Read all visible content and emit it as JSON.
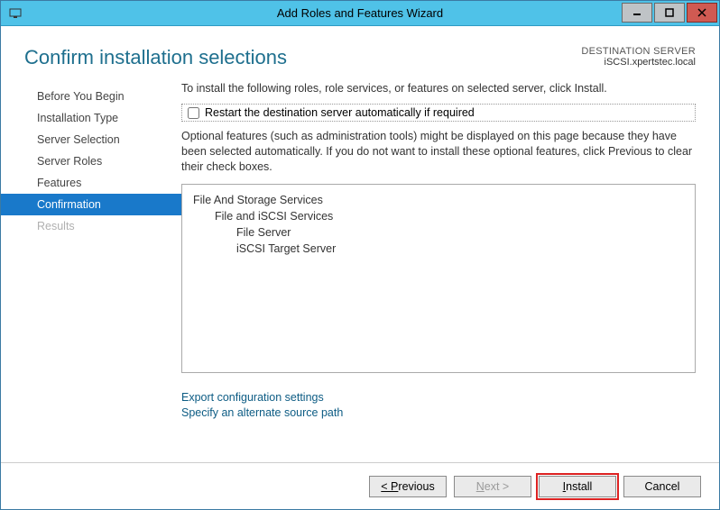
{
  "window": {
    "title": "Add Roles and Features Wizard"
  },
  "header": {
    "page_title": "Confirm installation selections",
    "destination_label": "DESTINATION SERVER",
    "destination_value": "iSCSI.xpertstec.local"
  },
  "sidebar": {
    "items": [
      {
        "label": "Before You Begin"
      },
      {
        "label": "Installation Type"
      },
      {
        "label": "Server Selection"
      },
      {
        "label": "Server Roles"
      },
      {
        "label": "Features"
      },
      {
        "label": "Confirmation"
      },
      {
        "label": "Results"
      }
    ]
  },
  "main": {
    "instruction": "To install the following roles, role services, or features on selected server, click Install.",
    "checkbox_label": "Restart the destination server automatically if required",
    "note": "Optional features (such as administration tools) might be displayed on this page because they have been selected automatically. If you do not want to install these optional features, click Previous to clear their check boxes.",
    "features": {
      "lvl0": "File And Storage Services",
      "lvl1": "File and iSCSI Services",
      "lvl2a": "File Server",
      "lvl2b": "iSCSI Target Server"
    },
    "links": {
      "export": "Export configuration settings",
      "altpath": "Specify an alternate source path"
    }
  },
  "footer": {
    "previous": "< Previous",
    "next": "Next >",
    "install": "Install",
    "cancel": "Cancel"
  }
}
